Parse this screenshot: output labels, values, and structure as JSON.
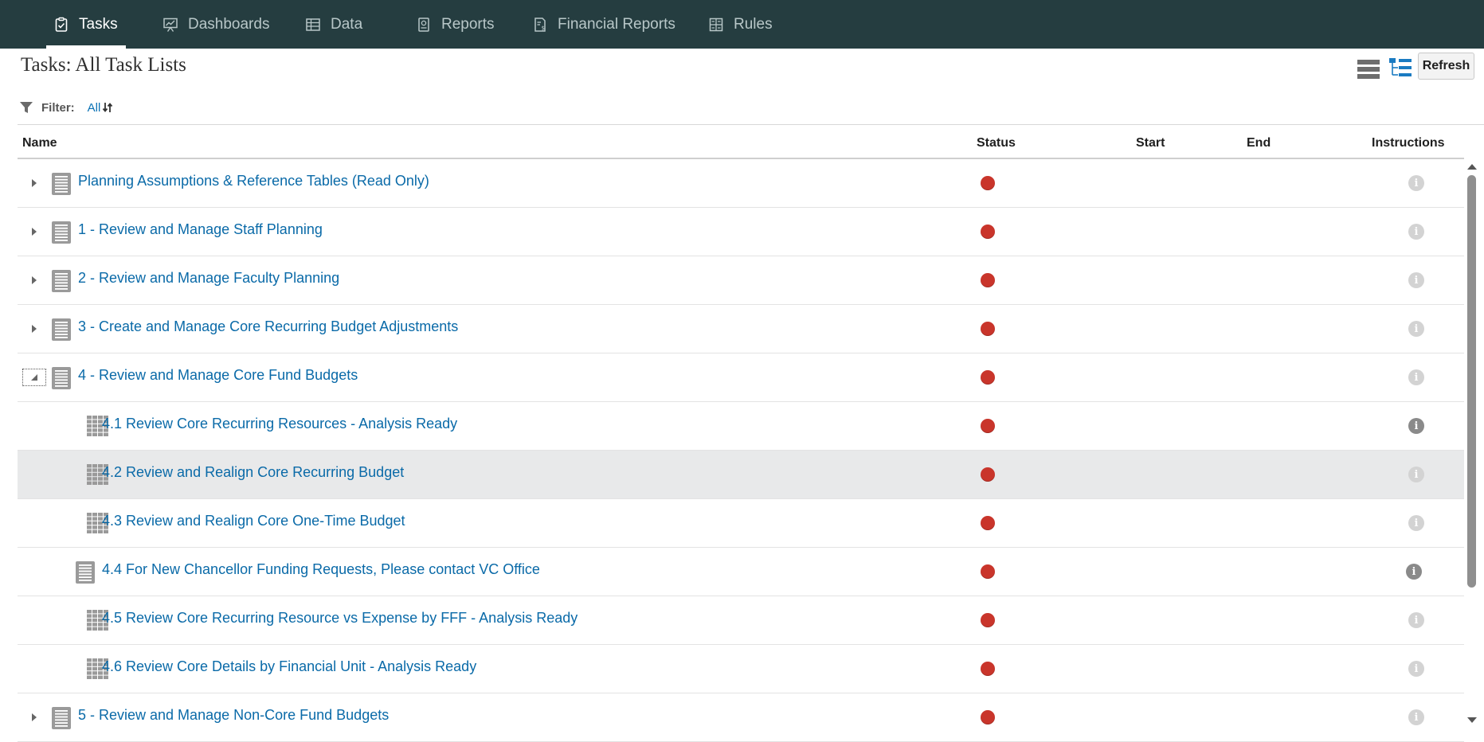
{
  "nav": {
    "items": [
      {
        "label": "Tasks",
        "icon": "clipboard-check-icon"
      },
      {
        "label": "Dashboards",
        "icon": "presentation-chart-icon"
      },
      {
        "label": "Data",
        "icon": "data-grid-icon"
      },
      {
        "label": "Reports",
        "icon": "report-icon"
      },
      {
        "label": "Financial Reports",
        "icon": "financial-report-icon"
      },
      {
        "label": "Rules",
        "icon": "rules-icon"
      }
    ],
    "active": "Tasks",
    "background": "#253d40"
  },
  "page": {
    "title": "Tasks: All Task Lists",
    "refresh_label": "Refresh",
    "view_modes": [
      "list-view",
      "tree-view"
    ]
  },
  "filter": {
    "label": "Filter:",
    "value": "All"
  },
  "table": {
    "columns": {
      "name": "Name",
      "status": "Status",
      "start": "Start",
      "end": "End",
      "instructions": "Instructions"
    },
    "rows": [
      {
        "name": "Planning Assumptions & Reference Tables (Read Only)",
        "level": 0,
        "type": "task-list",
        "toggle": "collapsed",
        "status": "red",
        "start": "",
        "end": ""
      },
      {
        "name": "1 - Review and Manage Staff Planning",
        "level": 0,
        "type": "task-list",
        "toggle": "collapsed",
        "status": "red",
        "start": "",
        "end": ""
      },
      {
        "name": "2 - Review and Manage Faculty Planning",
        "level": 0,
        "type": "task-list",
        "toggle": "collapsed",
        "status": "red",
        "start": "",
        "end": ""
      },
      {
        "name": "3 - Create and Manage Core Recurring Budget Adjustments",
        "level": 0,
        "type": "task-list",
        "toggle": "collapsed",
        "status": "red",
        "start": "",
        "end": ""
      },
      {
        "name": "4 - Review and Manage Core Fund Budgets",
        "level": 0,
        "type": "task-list",
        "toggle": "expanded",
        "status": "red",
        "start": "",
        "end": ""
      },
      {
        "name": "4.1 Review Core Recurring Resources - Analysis Ready",
        "level": 1,
        "type": "form",
        "status": "red",
        "start": "",
        "end": "",
        "info_dark": true
      },
      {
        "name": "4.2 Review and Realign Core Recurring Budget",
        "level": 1,
        "type": "form",
        "status": "red",
        "start": "",
        "end": "",
        "selected": true
      },
      {
        "name": "4.3 Review and Realign Core One-Time Budget",
        "level": 1,
        "type": "form",
        "status": "red",
        "start": "",
        "end": ""
      },
      {
        "name": "4.4 For New Chancellor Funding Requests, Please contact VC Office",
        "level": 1,
        "type": "task-list",
        "status": "red",
        "start": "",
        "end": "",
        "info_dark": true
      },
      {
        "name": "4.5 Review Core Recurring Resource vs Expense by FFF - Analysis Ready",
        "level": 1,
        "type": "form",
        "status": "red",
        "start": "",
        "end": ""
      },
      {
        "name": "4.6 Review Core Details by Financial Unit - Analysis Ready",
        "level": 1,
        "type": "form",
        "status": "red",
        "start": "",
        "end": ""
      },
      {
        "name": "5 - Review and Manage Non-Core Fund Budgets",
        "level": 0,
        "type": "task-list",
        "toggle": "collapsed",
        "status": "red",
        "start": "",
        "end": ""
      }
    ]
  },
  "colors": {
    "link": "#0a6aa8",
    "status_red": "#c9352b",
    "selected_row": "#e8e9ea",
    "nav_bg": "#253d40"
  }
}
